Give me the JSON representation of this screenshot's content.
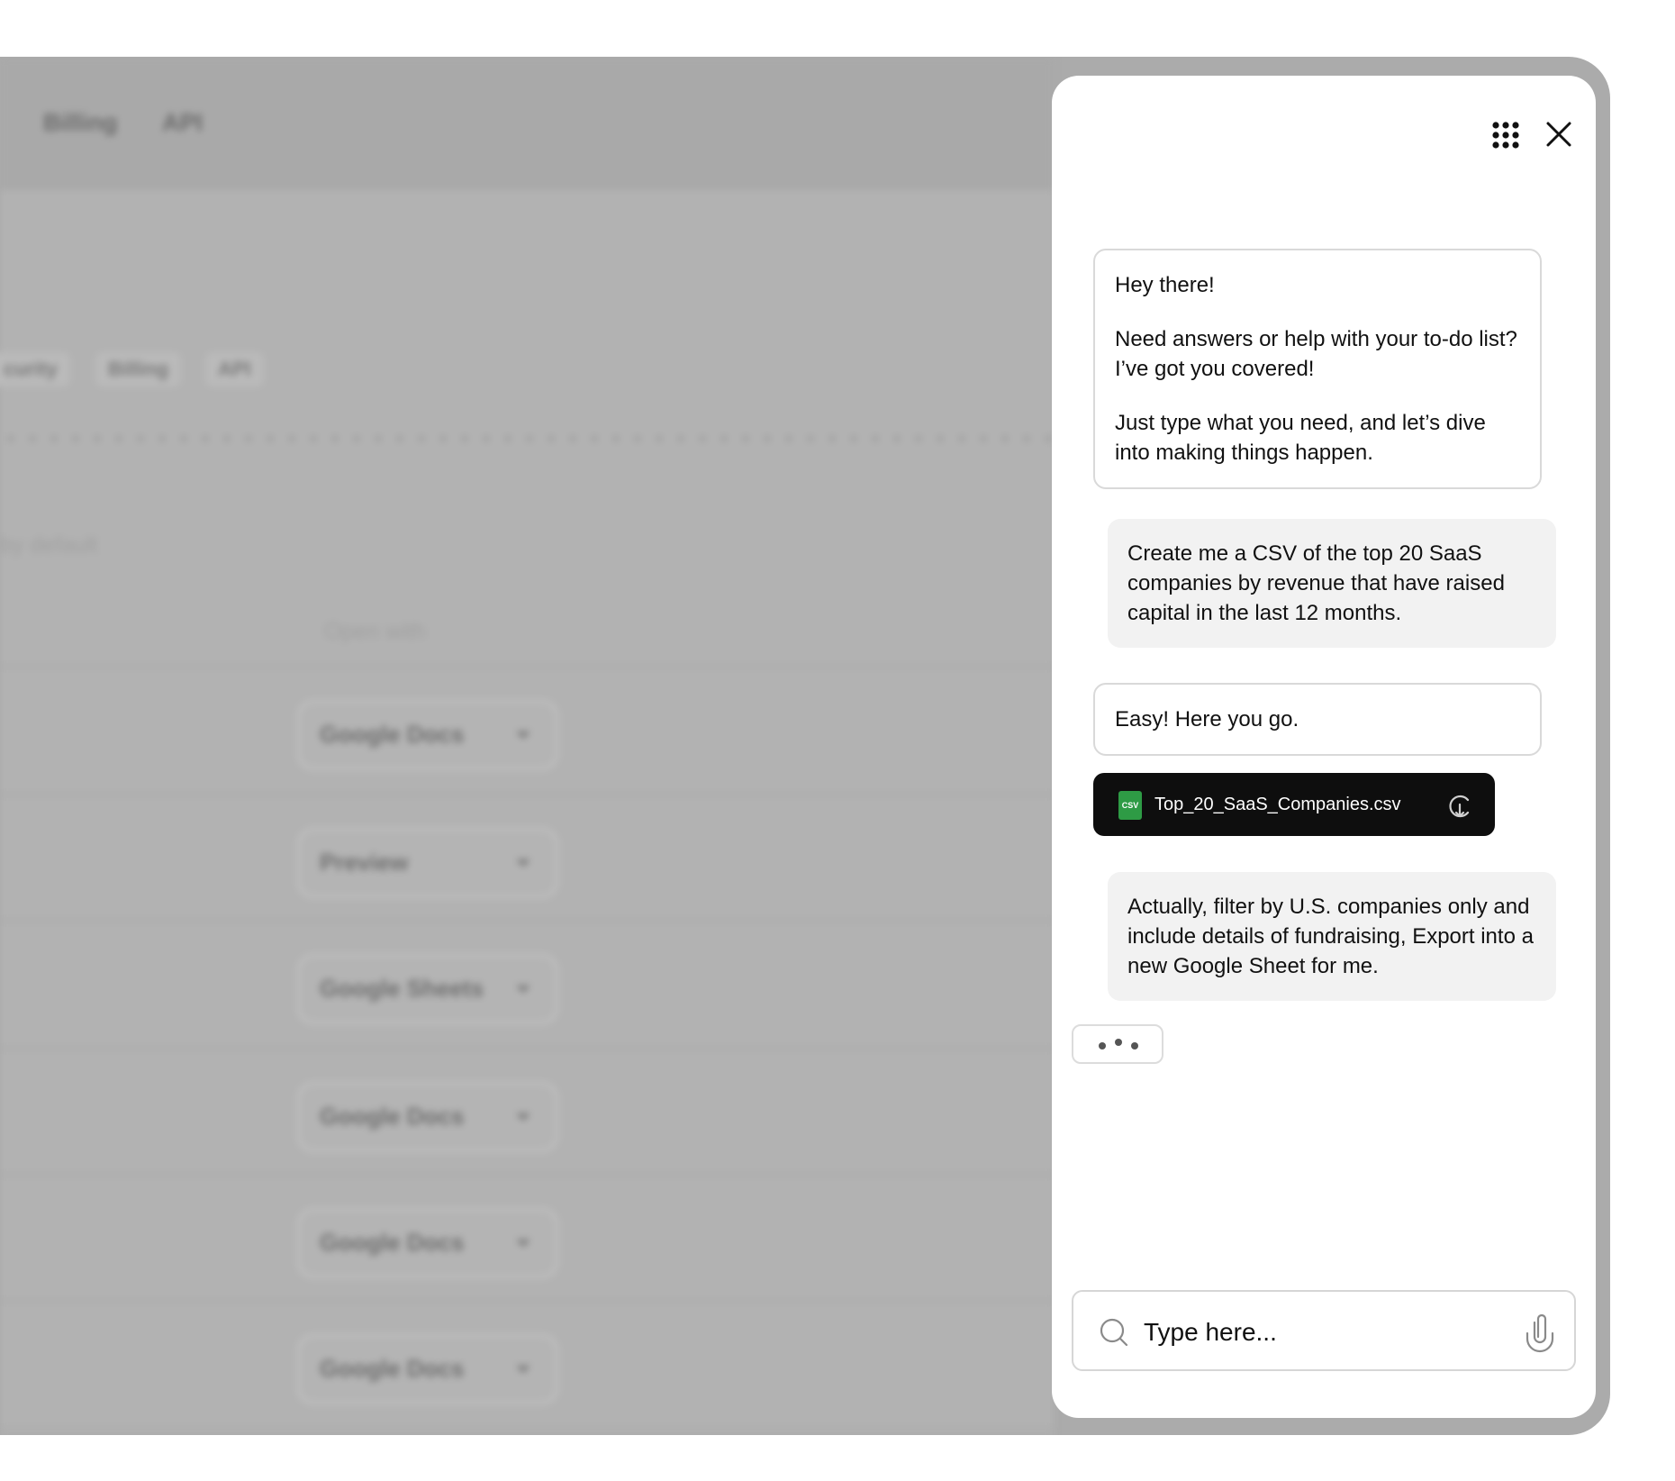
{
  "background": {
    "top_tabs": [
      "Billing",
      "API"
    ],
    "sub_tabs": [
      "curity",
      "Billing",
      "API"
    ],
    "left_hint": "by default",
    "column_header": "Open with",
    "dropdowns": [
      "Google Docs",
      "Preview",
      "Google Sheets",
      "Google Docs",
      "Google Docs",
      "Google Docs"
    ]
  },
  "chat": {
    "messages": {
      "greeting_1": "Hey there!",
      "greeting_2": "Need answers or help with your to-do list? I’ve got you covered!",
      "greeting_3": "Just type what you need, and let’s dive into making things happen.",
      "user_1": "Create me a CSV of the top 20 SaaS companies by revenue that have raised capital in the last 12 months.",
      "bot_2": "Easy! Here you go.",
      "user_2": "Actually, filter by U.S. companies only and include details of fundraising, Export into a new Google Sheet for me."
    },
    "attachment": {
      "icon_text": "CSV",
      "file_name": "Top_20_SaaS_Companies.csv"
    },
    "input": {
      "placeholder": "Type here..."
    },
    "icons": {
      "apps": "grid-icon",
      "close": "close-icon",
      "search": "search-icon",
      "attach": "paperclip-icon",
      "download": "download-icon"
    },
    "colors": {
      "file_card_bg": "#0e0e0e",
      "csv_green": "#2e9b45",
      "user_bubble_bg": "#f2f2f2"
    }
  }
}
